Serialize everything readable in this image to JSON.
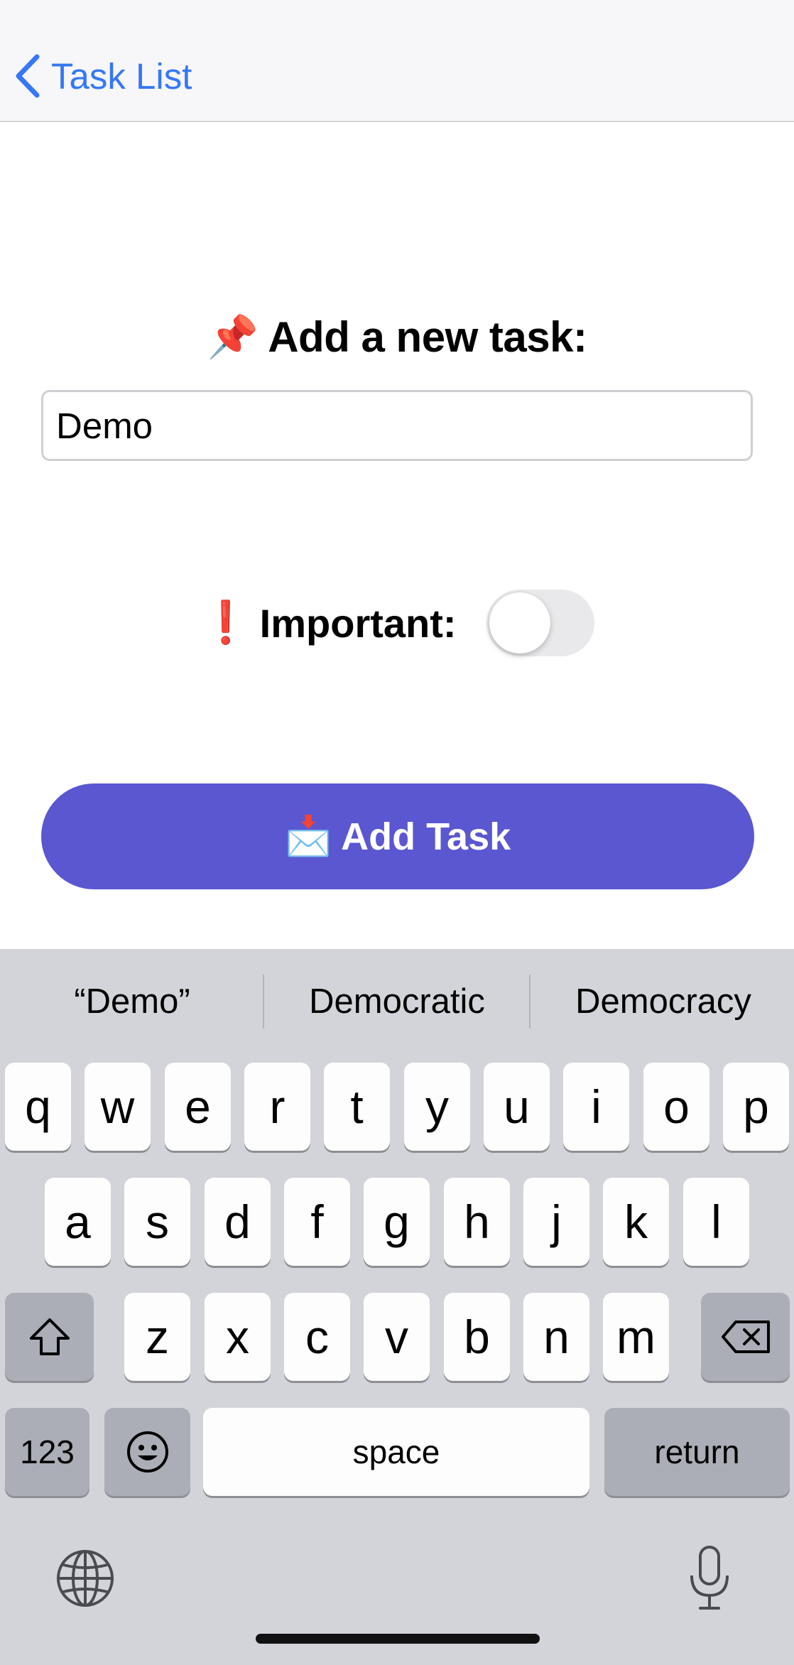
{
  "nav": {
    "back_label": "Task List"
  },
  "form": {
    "heading": "Add a new task:",
    "heading_emoji": "📌",
    "task_input_value": "Demo",
    "important_label": "Important:",
    "important_emoji": "❗",
    "important_on": false,
    "add_button_label": "Add Task",
    "add_button_emoji": "📩"
  },
  "keyboard": {
    "suggestions": [
      "“Demo”",
      "Democratic",
      "Democracy"
    ],
    "row1": [
      "q",
      "w",
      "e",
      "r",
      "t",
      "y",
      "u",
      "i",
      "o",
      "p"
    ],
    "row2": [
      "a",
      "s",
      "d",
      "f",
      "g",
      "h",
      "j",
      "k",
      "l"
    ],
    "row3": [
      "z",
      "x",
      "c",
      "v",
      "b",
      "n",
      "m"
    ],
    "numbers_key": "123",
    "space_key": "space",
    "return_key": "return"
  },
  "colors": {
    "accent_blue": "#3478f6",
    "button_purple": "#5a57d1",
    "keyboard_bg": "#d3d4d9"
  }
}
